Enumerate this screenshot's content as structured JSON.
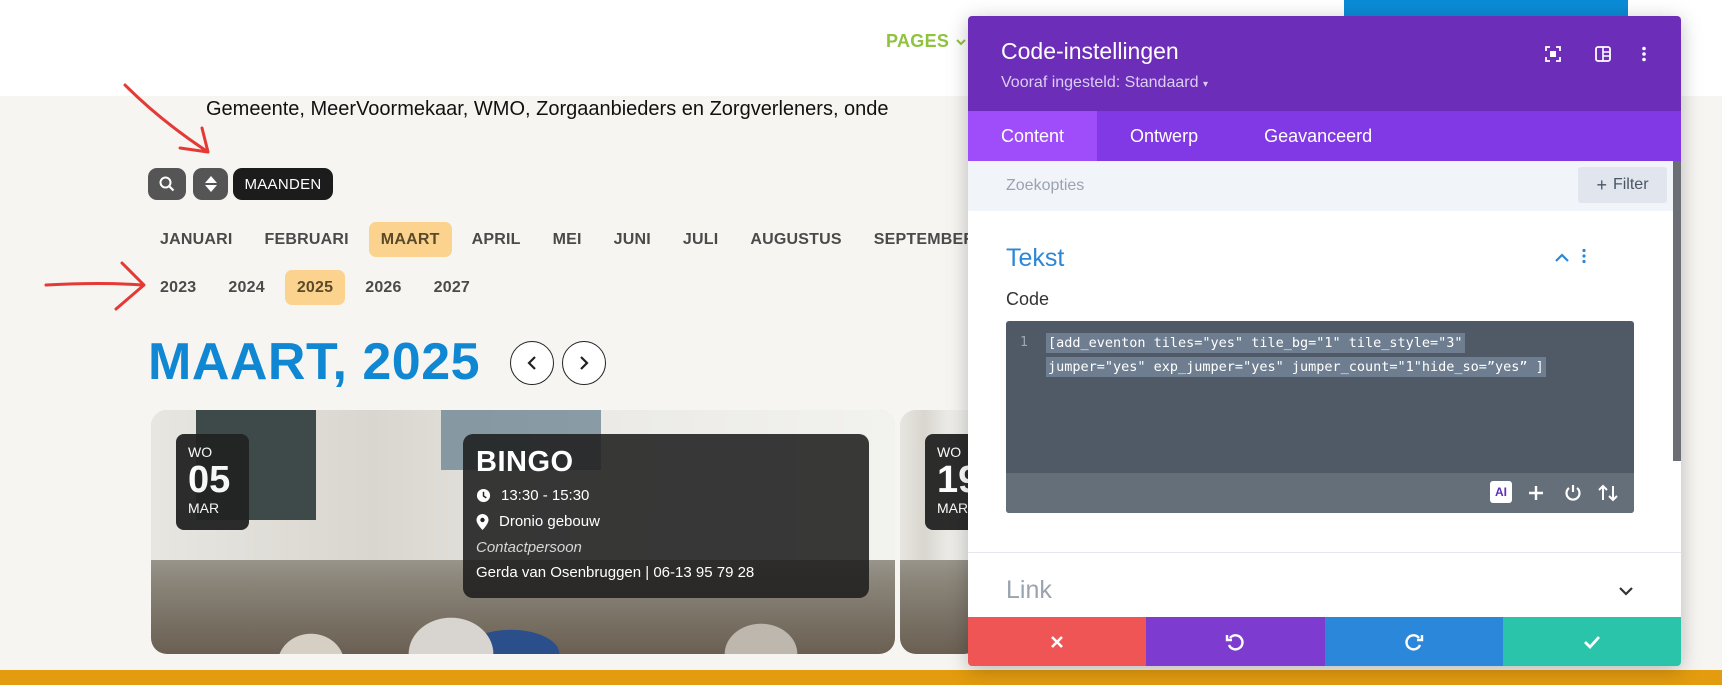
{
  "header": {
    "nav_pages": "PAGES"
  },
  "intro_text": "Gemeente, MeerVoormekaar,  WMO, Zorgaanbieders en Zorgverleners, onde",
  "calendar": {
    "months_button": "MAANDEN",
    "months": [
      "JANUARI",
      "FEBRUARI",
      "MAART",
      "APRIL",
      "MEI",
      "JUNI",
      "JULI",
      "AUGUSTUS",
      "SEPTEMBER"
    ],
    "active_month": "MAART",
    "years": [
      "2023",
      "2024",
      "2025",
      "2026",
      "2027"
    ],
    "active_year": "2025",
    "heading": "MAART, 2025"
  },
  "event1": {
    "dow": "WO",
    "day": "05",
    "month": "MAR",
    "title": "BINGO",
    "time": "13:30 - 15:30",
    "location": "Dronio gebouw",
    "contact_label": "Contactpersoon",
    "contact": "Gerda van Osenbruggen | 06-13 95 79 28"
  },
  "event2": {
    "dow": "WO",
    "day": "19",
    "month": "MAR"
  },
  "panel": {
    "title": "Code-instellingen",
    "preset": "Vooraf ingesteld: Standaard",
    "tabs": [
      "Content",
      "Ontwerp",
      "Geavanceerd"
    ],
    "search_placeholder": "Zoekopties",
    "filter_label": "Filter",
    "section_text": "Tekst",
    "code_label": "Code",
    "line_number": "1",
    "code_line1": "[add_eventon tiles=\"yes\" tile_bg=\"1\" tile_style=\"3\"",
    "code_line2": "jumper=\"yes\" exp_jumper=\"yes\" jumper_count=\"1\"hide_so=”yes” ]",
    "ai_label": "AI",
    "section_link": "Link"
  },
  "colors": {
    "accent_purple": "#6c2eb9",
    "tab_purple": "#8138e5",
    "heading_blue": "#0f87d3",
    "pill_active": "#fbd38e",
    "cancel_red": "#ef5555",
    "undo_purple": "#7e3bd0",
    "redo_blue": "#2b87da",
    "save_green": "#29c4a9"
  }
}
